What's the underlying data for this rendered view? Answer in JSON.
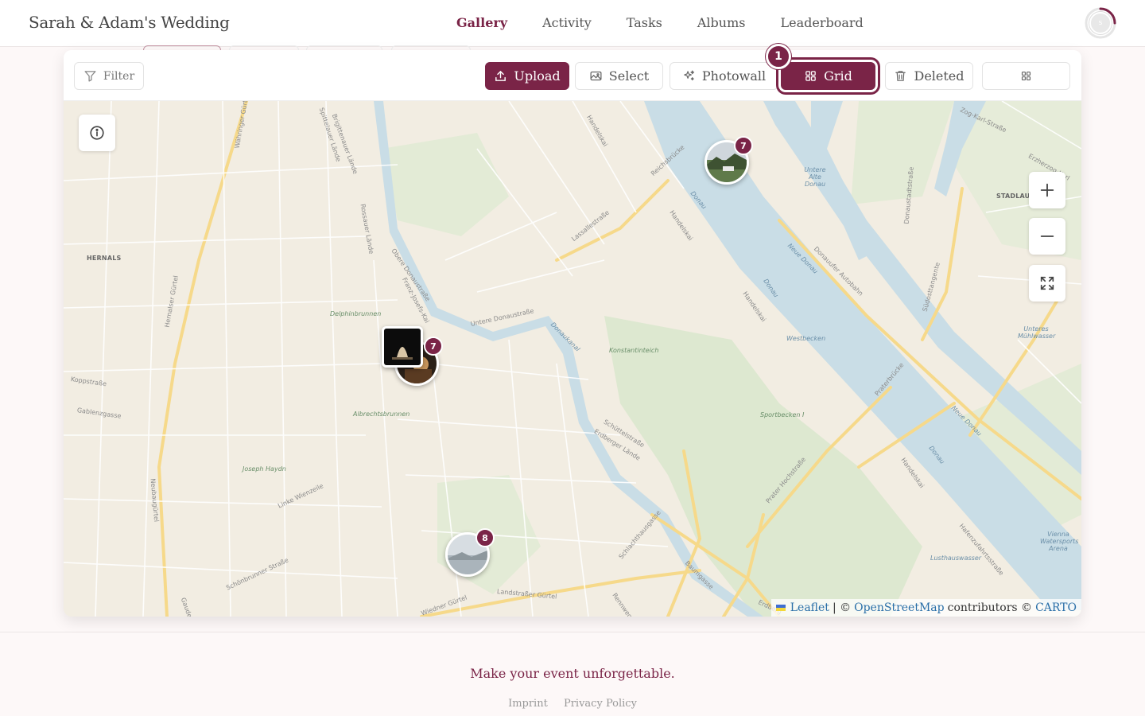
{
  "header": {
    "site_title": "Sarah & Adam's Wedding",
    "nav": [
      {
        "label": "Gallery",
        "active": true
      },
      {
        "label": "Activity"
      },
      {
        "label": "Tasks"
      },
      {
        "label": "Albums"
      },
      {
        "label": "Leaderboard"
      }
    ],
    "avatar_initial": "s"
  },
  "toolbar": {
    "filter_label": "Filter",
    "upload_label": "Upload",
    "select_label": "Select",
    "photowall_label": "Photowall",
    "grid_label": "Grid",
    "deleted_label": "Deleted",
    "step_badge": "1"
  },
  "map": {
    "labels": {
      "hernals": "HERNALS",
      "stadlau": "STADLAU",
      "delphinbrunnen": "Delphinbrunnen",
      "albrechtsbrunnen": "Albrechtsbrunnen",
      "joseph_haydn": "Joseph Haydn",
      "konstantinteich": "Konstantinteich",
      "westbecken": "Westbecken",
      "sportbecken": "Sportbecken I",
      "untere_alte_donau": "Untere Alte Donau",
      "unteres_muehlwasser": "Unteres Mühlwasser",
      "lusthauswasser": "Lusthauswasser",
      "vienna_watersports": "Vienna Watersports Arena",
      "donau_1": "Donau",
      "donau_2": "Donau",
      "donau_3": "Donau",
      "neue_donau_1": "Neue Donau",
      "neue_donau_2": "Neue Donau",
      "donaukanal": "Donaukanal",
      "handelskai_1": "Handelskai",
      "handelskai_2": "Handelskai",
      "handelskai_3": "Handelskai",
      "handelskai_4": "Handelskai",
      "guertel_1": "Währinger Gürtel",
      "guertel_2": "Hernalser Gürtel",
      "guertel_3": "Neubaugürtel",
      "guertel_4": "Wiedner Gürtel",
      "guertel_5": "Landstraßer Gürtel",
      "lassallestrasse": "Lassallestraße",
      "reichsbruecke": "Reichsbrücke",
      "praterbruecke": "Praterbrücke",
      "obere_donaustrasse": "Obere Donaustraße",
      "untere_donaustrasse": "Untere Donaustraße",
      "franz_josefs_kai": "Franz-Josefs-Kai",
      "rossauer_laende": "Rossauer Lände",
      "brigittenauer_laende": "Brigittenauer Lände",
      "spittelauer_laende": "Spittelauer Lände",
      "koppstrasse": "Koppstraße",
      "gablenzgasse": "Gablenzgasse",
      "linke_wienzeile": "Linke Wienzeile",
      "schoenbrunner_strasse": "Schönbrunner Straße",
      "schuettelstrasse": "Schüttelstraße",
      "erdberger_laende": "Erdberger Lände",
      "prater_hochstrasse": "Prater Hochstraße",
      "donauufer_autobahn": "Donauufer Autobahn",
      "donaustadtstrasse": "Donaustadtstraße",
      "suedosttangente": "Südosttangente",
      "schlachthausgasse": "Schlachthausgasse",
      "baumgasse": "Baumgasse",
      "zeug_karl_strasse": "Zog-Karl-Straße",
      "erzherzog_karl": "Erzherzog-Karl",
      "rennweg": "Rennweg",
      "erdberg": "Erdberg",
      "gaudenzdorfer": "Gauden",
      "hafenzufahrtsstrasse": "Hafenzufahrtsstraße"
    },
    "clusters": [
      {
        "count": "7"
      },
      {
        "count": "7"
      },
      {
        "count": "8"
      }
    ],
    "attribution": {
      "leaflet": "Leaflet",
      "sep": "| ©",
      "osm": "OpenStreetMap",
      "contrib": "contributors ©",
      "carto": "CARTO"
    }
  },
  "footer": {
    "tagline": "Make your event unforgettable.",
    "imprint": "Imprint",
    "privacy": "Privacy Policy"
  },
  "colors": {
    "brand": "#7a2447",
    "map_land": "#f2ede2",
    "map_water": "#c9dde6",
    "map_park": "#dde8d0"
  }
}
